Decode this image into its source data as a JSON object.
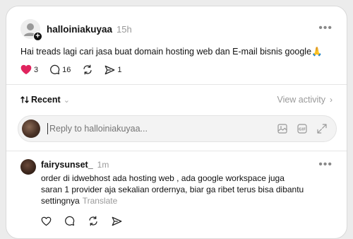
{
  "post": {
    "username": "halloiniakuyaa",
    "time": "15h",
    "text": "Hai treads lagi cari jasa buat domain hosting web dan E-mail bisnis google",
    "emoji": "🙏",
    "likes": "3",
    "comments": "16",
    "shares": "1",
    "like_color": "#e0245e"
  },
  "sort": {
    "label": "Recent",
    "view_activity": "View activity"
  },
  "reply": {
    "placeholder": "Reply to halloiniakuyaa..."
  },
  "comment": {
    "username": "fairysunset_",
    "time": "1m",
    "line1": "order di idwebhost ada hosting web , ada google workspace juga",
    "line2": "saran 1 provider aja sekalian ordernya, biar ga ribet terus bisa dibantu",
    "line3": "settingnya",
    "translate": "Translate"
  },
  "more_glyph": "•••"
}
